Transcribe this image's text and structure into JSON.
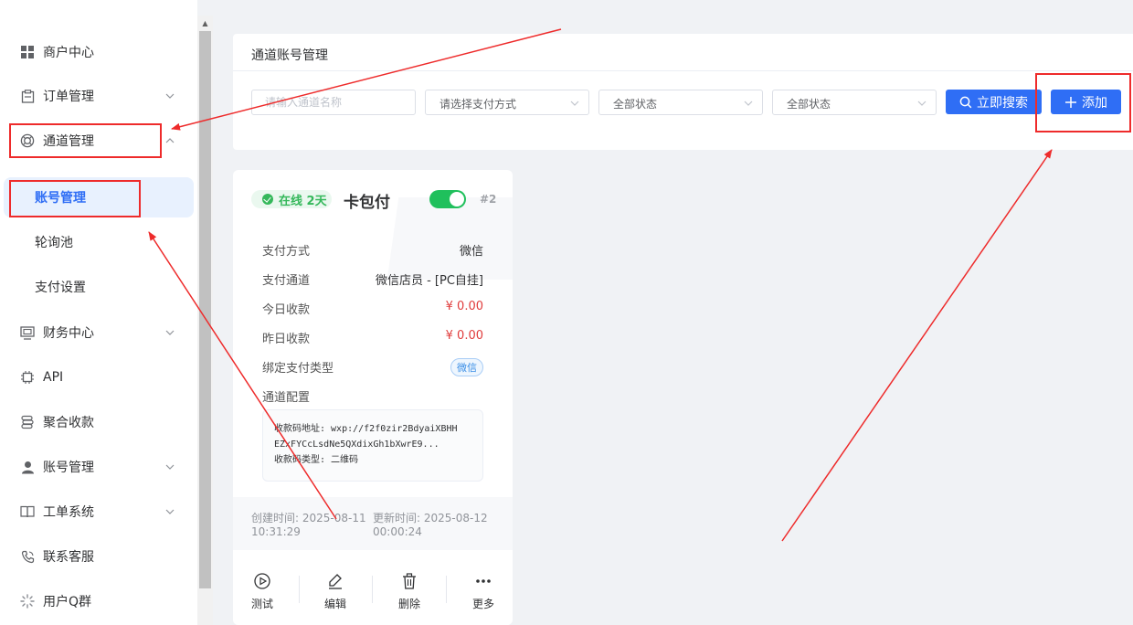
{
  "sidebar": {
    "items": [
      {
        "label": "商户中心",
        "icon": "grid-icon"
      },
      {
        "label": "订单管理",
        "icon": "clipboard-icon"
      },
      {
        "label": "通道管理",
        "icon": "lifebuoy-icon"
      },
      {
        "label": "财务中心",
        "icon": "monitor-icon"
      },
      {
        "label": "API",
        "icon": "chip-icon"
      },
      {
        "label": "聚合收款",
        "icon": "stack-icon"
      },
      {
        "label": "账号管理",
        "icon": "user-icon"
      },
      {
        "label": "工单系统",
        "icon": "book-icon"
      },
      {
        "label": "联系客服",
        "icon": "phone-icon"
      },
      {
        "label": "用户Q群",
        "icon": "spinner-icon"
      }
    ],
    "sub_items": [
      {
        "label": "账号管理"
      },
      {
        "label": "轮询池"
      },
      {
        "label": "支付设置"
      }
    ]
  },
  "filter": {
    "title": "通道账号管理",
    "name_placeholder": "请输入通道名称",
    "pay_method_placeholder": "请选择支付方式",
    "status1": "全部状态",
    "status2": "全部状态",
    "search_label": "立即搜索",
    "add_label": "添加"
  },
  "card": {
    "status": "在线 2天",
    "name": "卡包付",
    "id": "#2",
    "toggle_on": true,
    "rows": [
      {
        "label": "支付方式",
        "value": "微信"
      },
      {
        "label": "支付通道",
        "value": "微信店员 - [PC自挂]"
      },
      {
        "label": "今日收款",
        "value": "¥ 0.00"
      },
      {
        "label": "昨日收款",
        "value": "¥ 0.00"
      }
    ],
    "bind_label": "绑定支付类型",
    "bind_tag": "微信",
    "config_label": "通道配置",
    "config_lines": [
      "收款码地址: wxp://f2f0zir2BdyaiXBHH",
      "EZxFYCcLsdNe5QXdixGh1bXwrE9...",
      "收款码类型: 二维码"
    ],
    "created_label": "创建时间: 2025-08-11",
    "created_time": "10:31:29",
    "updated_label": "更新时间: 2025-08-12",
    "updated_time": "00:00:24",
    "actions": [
      {
        "label": "测试",
        "icon": "play-icon"
      },
      {
        "label": "编辑",
        "icon": "edit-icon"
      },
      {
        "label": "删除",
        "icon": "trash-icon"
      },
      {
        "label": "更多",
        "icon": "more-icon"
      }
    ]
  },
  "colors": {
    "primary": "#2f6ef5",
    "online_green": "#35b85b",
    "toggle_green": "#20c05c",
    "money_red": "#e03c3c",
    "annotation_red": "#ee2b2b"
  }
}
